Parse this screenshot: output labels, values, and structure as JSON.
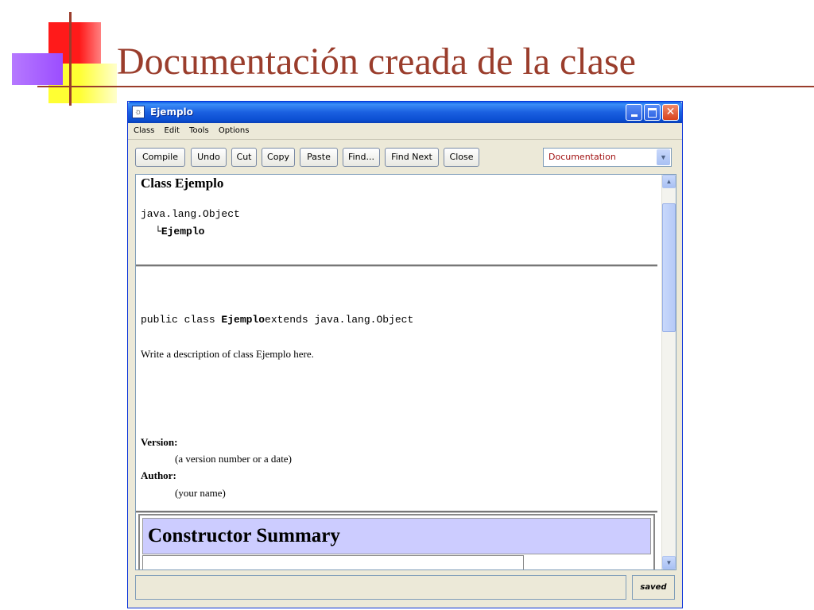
{
  "slide": {
    "title": "Documentación creada de la clase"
  },
  "window": {
    "title": "Ejemplo",
    "controls": {
      "minimize": "minimize",
      "maximize": "maximize",
      "close": "✕"
    }
  },
  "menu": [
    "Class",
    "Edit",
    "Tools",
    "Options"
  ],
  "toolbar": {
    "buttons": [
      "Compile",
      "Undo",
      "Cut",
      "Copy",
      "Paste",
      "Find...",
      "Find Next",
      "Close"
    ],
    "view_select": "Documentation"
  },
  "doc": {
    "class_heading": "Class Ejemplo",
    "hierarchy_root": "java.lang.Object",
    "hierarchy_branch": "└",
    "hierarchy_child": "Ejemplo",
    "declaration_prefix": "public class ",
    "declaration_name": "Ejemplo",
    "declaration_suffix": "extends java.lang.Object",
    "description": "Write a description of class Ejemplo here.",
    "version_label": "Version:",
    "version_value": "(a version number or a date)",
    "author_label": "Author:",
    "author_value": "(your name)",
    "constructor_summary": "Constructor Summary"
  },
  "status": {
    "message": "",
    "saved": "saved"
  },
  "icons": {
    "app": "bluej-bird-icon",
    "scroll_up": "chevron-up-icon",
    "scroll_down": "chevron-down-icon",
    "select_arrow": "chevron-down-icon"
  },
  "colors": {
    "title_text": "#9a3d2c",
    "titlebar": "#0b4fd2",
    "select_text": "#a01010",
    "constructor_header": "#ccccff"
  }
}
